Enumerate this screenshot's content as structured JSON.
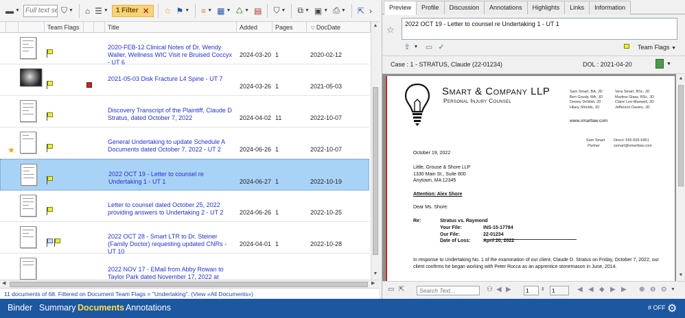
{
  "toolbar": {
    "search_placeholder": "Full text search",
    "filter_badge": "1 Filter",
    "filter_clear": "✕"
  },
  "columns": {
    "team_flags": "Team Flags",
    "title": "Title",
    "added": "Added",
    "pages": "Pages",
    "docdate": "DocDate"
  },
  "documents": [
    {
      "title": "2020-FEB-12 Clinical Notes of Dr. Wendy Waller, Wellness WIC Visit re Bruised Coccyx - UT 6",
      "added": "2024-03-20",
      "pages": "1",
      "docdate": "2020-02-12"
    },
    {
      "title": "2021-05-03 Disk Fracture L4 Spine - UT 7",
      "added": "2024-03-26",
      "pages": "1",
      "docdate": "2021-05-03"
    },
    {
      "title": "Discovery Transcript of the Plaintiff, Claude D Stratus, dated October 7, 2022",
      "added": "2024-04-02",
      "pages": "11",
      "docdate": "2022-10-07"
    },
    {
      "title": "General Undertaking to update Schedule A Documents dated October 7, 2022 - UT 2",
      "added": "2024-06-26",
      "pages": "1",
      "docdate": "2022-10-07"
    },
    {
      "title": "2022 OCT 19 - Letter to counsel re Undertaking 1 - UT 1",
      "added": "2024-06-27",
      "pages": "1",
      "docdate": "2022-10-19"
    },
    {
      "title": "Letter to counsel dated October 25, 2022 providing answers to Undertaking 2 - UT 2",
      "added": "2024-06-26",
      "pages": "1",
      "docdate": "2022-10-25"
    },
    {
      "title": "2022 OCT 28 - Smart LTR to Dr. Steiner (Family Doctor) requesting updated CNRs - UT 10",
      "added": "2024-04-01",
      "pages": "1",
      "docdate": "2022-10-28"
    },
    {
      "title": "2022 NOV 17 - EMail from Abby Rowan to Taylor Park dated November 17, 2022 at 15:43 re:",
      "added": "",
      "pages": "",
      "docdate": ""
    }
  ],
  "status_text": "11 documents of 68.  Filtered on Document Team Flags = \"Undertaking\". (View «All Documents»)",
  "tabs": [
    "Preview",
    "Profile",
    "Discussion",
    "Annotations",
    "Highlights",
    "Links",
    "Information"
  ],
  "preview": {
    "title": "2022 OCT 19 - Letter to counsel re Undertaking 1 - UT 1",
    "team_flags_label": "Team Flags",
    "case": "Case : 1 - STRATUS, Claude (22-01234)",
    "dol": "DOL : 2021-04-20",
    "search_placeholder": "Search Text...",
    "page": "1",
    "page_total": "1"
  },
  "letter": {
    "firm": "Smart & Company LLP",
    "firm_sub": "Personal Injury Counsel",
    "lawyers_col1": [
      "Sam Smart, BA, JD",
      "Ben Goudy, MA, JD",
      "Dewey DeWall, JD",
      "Hilary Shields, JD"
    ],
    "lawyers_col2": [
      "Vera Smart, BSc, JD",
      "Martina Glass, BSc, JD",
      "Claire Lee-Maxwell, JD",
      "Jefferson Davies, JD"
    ],
    "website": "www.smartlaw.com",
    "sender_name": "Sam Smart",
    "sender_title": "Partner",
    "direct": "Direct: 555-555-5451",
    "email": "ssmart@smartlaw.com",
    "date": "October 19, 2022",
    "addr1": "Little, Grouse & Shore LLP",
    "addr2": "1330 Main St., Suite 800",
    "addr3": "Anytown, MA 12345",
    "attention": "Attention: Alex Shore",
    "salutation": "Dear Ms. Shore:",
    "re_label": "Re:",
    "re_case": "Stratus vs. Raymond",
    "your_file_label": "Your File:",
    "your_file": "INS-15-17784",
    "our_file_label": "Our File:",
    "our_file": "22-01234",
    "dol_label": "Date of Loss:",
    "dol": "April 20, 2022",
    "body": "In response to Undertaking No. 1 of the examination of our client, Claude D. Stratus on Friday, October 7, 2022, our client confirms he began working with Peter Rocca as an apprentice stonemason in June, 2014."
  },
  "bottom_nav": [
    "Binder",
    "Summary",
    "Documents",
    "Annotations"
  ],
  "bottom_right": "# OFF"
}
